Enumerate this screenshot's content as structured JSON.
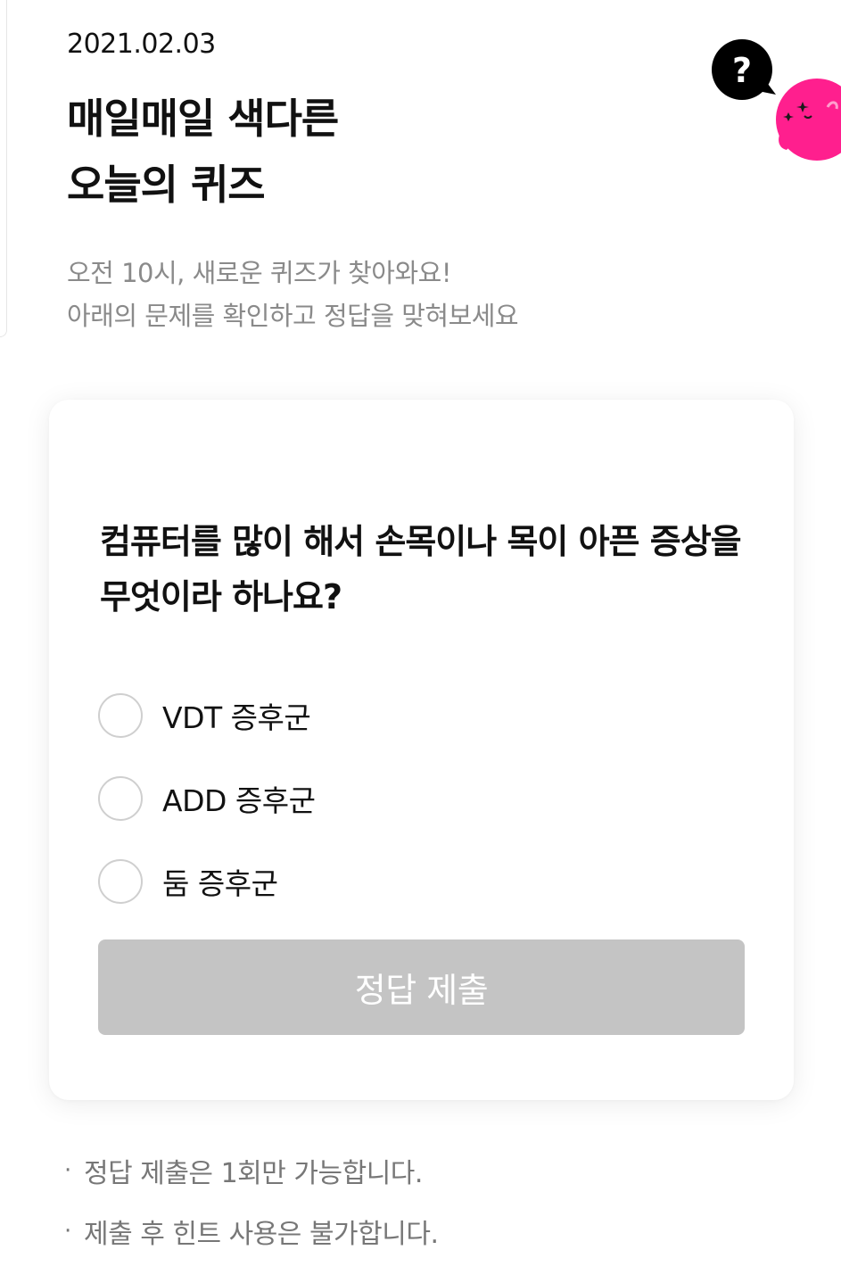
{
  "header": {
    "date": "2021.02.03",
    "title_lines": [
      "매일매일 색다른",
      "오늘의 퀴즈"
    ],
    "subtitle_lines": [
      "오전 10시, 새로운 퀴즈가 찾아와요!",
      "아래의 문제를 확인하고 정답을 맞혀보세요"
    ]
  },
  "help_button": {
    "icon": "question-mark-icon",
    "glyph": "?"
  },
  "mascot": {
    "icon": "pink-mascot-icon",
    "color": "#ff1f8e"
  },
  "quiz": {
    "question": "컴퓨터를 많이 해서 손목이나 목이 아픈 증상을 무엇이라 하나요?",
    "options": [
      {
        "label": "VDT 증후군"
      },
      {
        "label": "ADD 증후군"
      },
      {
        "label": "둠 증후군"
      }
    ],
    "submit_label": "정답 제출"
  },
  "notes": [
    {
      "bullet": "·",
      "text": "정답 제출은 1회만 가능합니다."
    },
    {
      "bullet": "·",
      "text": "제출 후 힌트 사용은 불가합니다."
    }
  ],
  "colors": {
    "accent": "#ff1f8e",
    "submit_disabled": "#c4c4c4",
    "subtext": "#8a8a8a"
  }
}
